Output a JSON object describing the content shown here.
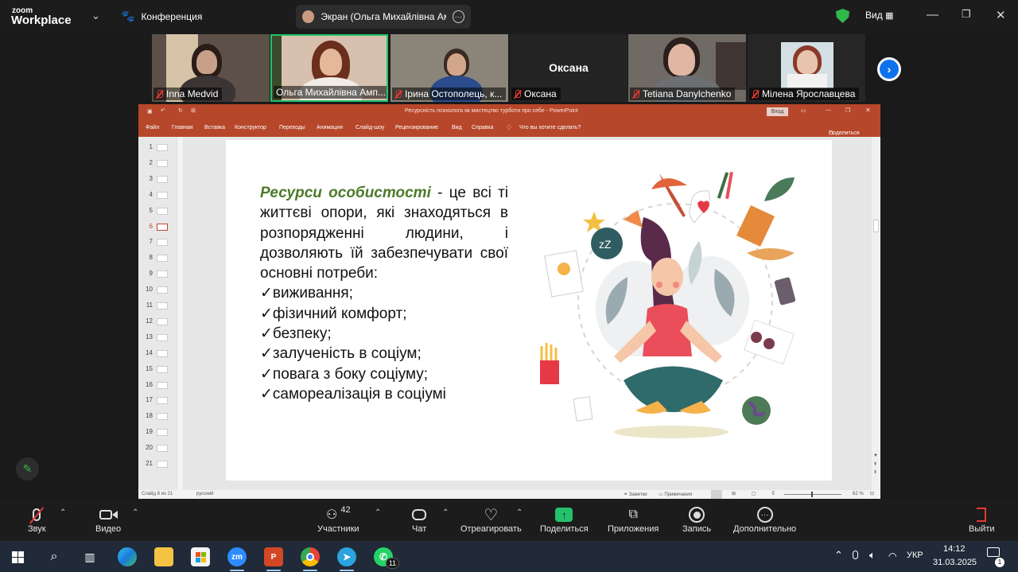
{
  "topbar": {
    "logo_small": "zoom",
    "logo_big": "Workplace",
    "conference_label": "Конференция",
    "screen_share_label": "Экран (Ольга Михайлівна Ампі",
    "view_label": "Вид",
    "shield_color": "#2fb94a"
  },
  "gallery": [
    {
      "name": "Inna Medvid",
      "muted": true
    },
    {
      "name": "Ольга Михайлівна Амп...",
      "muted": false,
      "active": true
    },
    {
      "name": "Ірина Остополець, к...",
      "muted": true
    },
    {
      "name": "Оксана",
      "muted": true,
      "center_label": "Оксана"
    },
    {
      "name": "Tetiana Danylchenko",
      "muted": true
    },
    {
      "name": "Мілена Ярославцева",
      "muted": true
    }
  ],
  "ppt": {
    "title": "Ресурсність психолога як мистецтво турботи про себе  -  PowerPoint",
    "login_button": "Вход",
    "menu": [
      "Файл",
      "Главная",
      "Вставка",
      "Конструктор",
      "Переходы",
      "Анимация",
      "Слайд-шоу",
      "Рецензирование",
      "Вид",
      "Справка"
    ],
    "tell_me": "Что вы хотите сделать?",
    "share": "Поделиться",
    "thumbnails": [
      "1",
      "2",
      "3",
      "4",
      "5",
      "6",
      "7",
      "8",
      "9",
      "10",
      "11",
      "12",
      "13",
      "14",
      "15",
      "16",
      "17",
      "18",
      "19",
      "20",
      "21"
    ],
    "selected_thumbnail": "6",
    "status_slide": "Слайд 6 из 21",
    "status_lang": "русский",
    "status_notes": "Заметки",
    "status_comments": "Примечания",
    "zoom": "62 %",
    "accent_color": "#b7472a"
  },
  "slide": {
    "highlight": "Ресурси особистості",
    "intro": " - це всі ті життєві опори, які знаходяться в розпорядженні людини, і дозволяють їй забезпечувати свої основні потреби:",
    "items": [
      "виживання;",
      "фізичний комфорт;",
      "безпеку;",
      "залученість в соціум;",
      "повага з боку соціуму;",
      "самореалізація в соціумі"
    ]
  },
  "toolbar": {
    "sound": "Звук",
    "video": "Видео",
    "participants": "Участники",
    "participants_count": "42",
    "chat": "Чат",
    "react": "Отреагировать",
    "share": "Поделиться",
    "apps": "Приложения",
    "record": "Запись",
    "more": "Дополнительно",
    "leave": "Выйти"
  },
  "taskbar": {
    "zoom_app": "zm",
    "ppt_app": "P",
    "whatsapp_badge": "11",
    "lang": "УКР",
    "time": "14:12",
    "date": "31.03.2025",
    "notif_count": "1"
  }
}
